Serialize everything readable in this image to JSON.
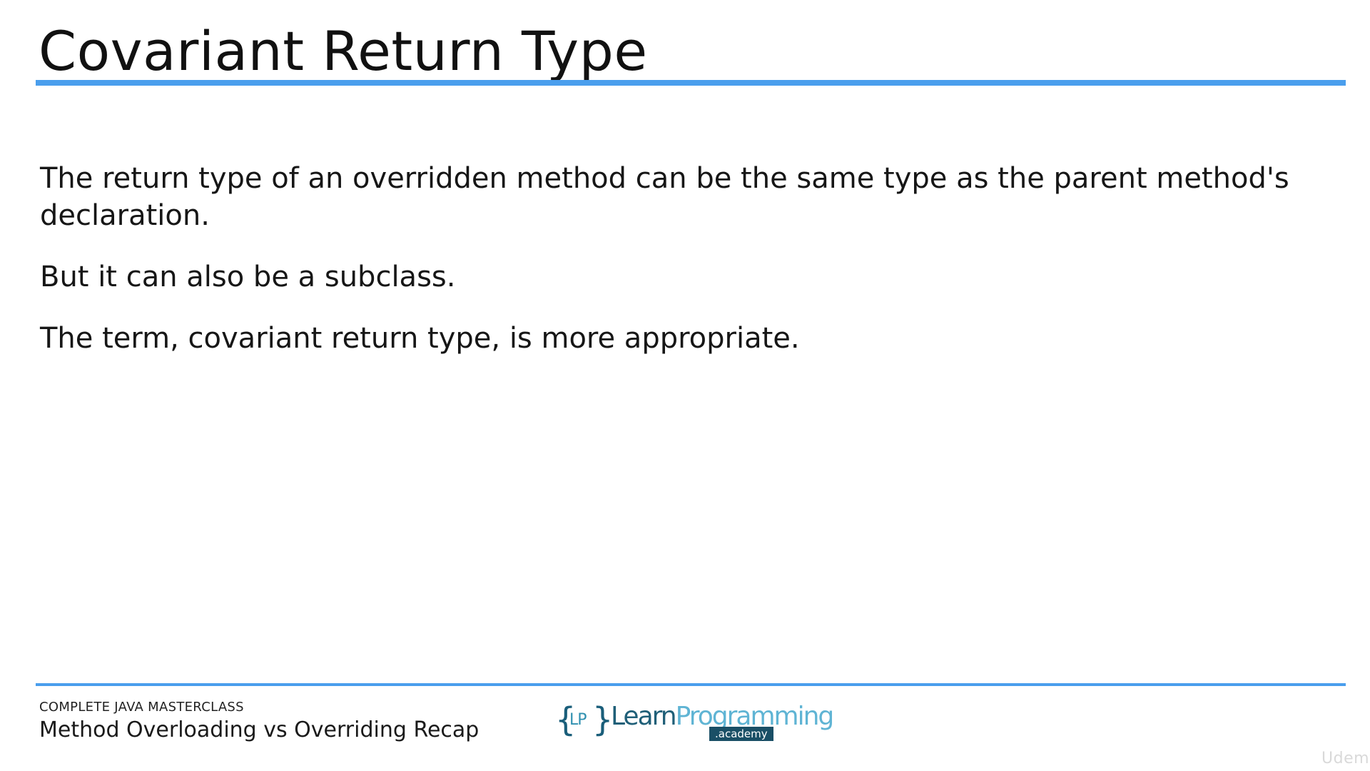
{
  "slide": {
    "title": "Covariant Return Type",
    "paragraphs": [
      "The return type of an overridden method can be the same type as the parent method's declaration.",
      "But it can also be a subclass.",
      "The term, covariant return type, is more appropriate."
    ]
  },
  "footer": {
    "course": "COMPLETE JAVA MASTERCLASS",
    "lecture": "Method Overloading vs Overriding Recap"
  },
  "logo": {
    "brace_left": "{",
    "initials": "LP",
    "brace_right": "}",
    "word_learn": "Learn",
    "word_programming": "Programming",
    "tag": ".academy"
  },
  "watermark": "Udemy",
  "colors": {
    "accent_rule": "#4a9eed",
    "logo_dark": "#1f5f78",
    "logo_light": "#5fb4d4"
  }
}
